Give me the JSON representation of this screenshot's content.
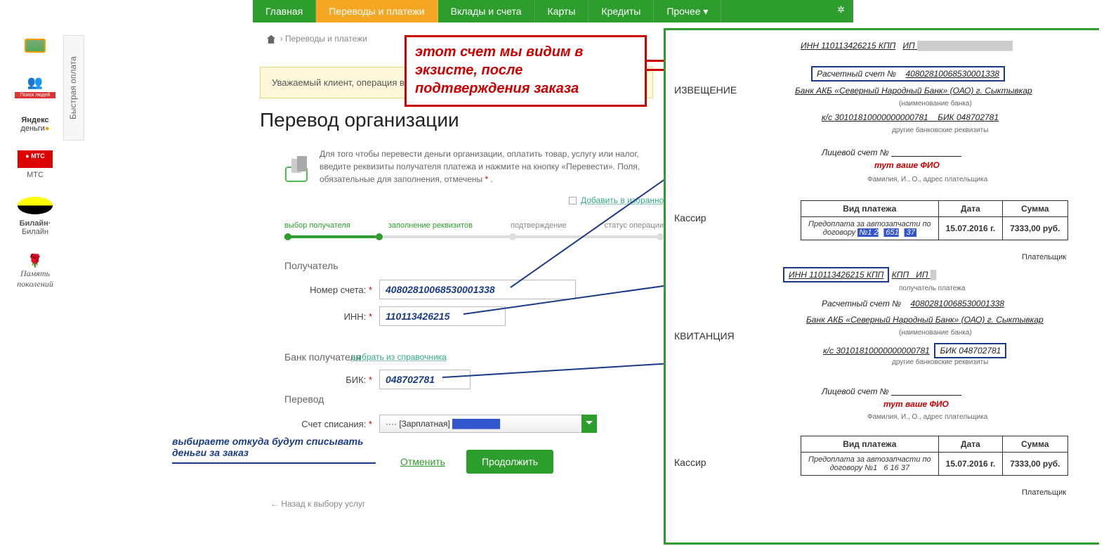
{
  "nav": {
    "home": "Главная",
    "transfers": "Переводы и платежи",
    "deposits": "Вклады и счета",
    "cards": "Карты",
    "credits": "Кредиты",
    "other": "Прочее"
  },
  "quickpay": "Быстрая оплата",
  "sidebar": {
    "mts": "МТС",
    "beeline": "Билайн",
    "yandex_money": "деньги"
  },
  "breadcrumb": "Переводы и платежи",
  "alert": "Уважаемый клиент, операция возм",
  "heading": "Перевод организации",
  "description": "Для того чтобы перевести деньги организации, оплатить товар, услугу или налог, введите реквизиты получателя платежа и нажмите на кнопку «Перевести». Поля, обязательные для заполнения, отмечены",
  "add_favorite": "Добавить в избранное",
  "steps": {
    "s1": "выбор получателя",
    "s2": "заполнение реквизитов",
    "s3": "подтверждение",
    "s4": "статус операции"
  },
  "form": {
    "recipient_section": "Получатель",
    "account_label": "Номер счета:",
    "account_value": "40802810068530001338",
    "inn_label": "ИНН:",
    "inn_value": "110113426215",
    "bank_section": "Банк получателя",
    "directory_link": "выбрать из справочника",
    "bik_label": "БИК:",
    "bik_value": "048702781",
    "transfer_section": "Перевод",
    "writeoff_label": "Счет списания:",
    "writeoff_value": "···· [Зарплатная]",
    "cancel": "Отменить",
    "continue": "Продолжить",
    "back": "← Назад к выбору услуг"
  },
  "redbox": "этот счет мы видим в экзисте, после подтверждения заказа",
  "blueanno": "выбираете откуда будут списывать деньги за заказ",
  "invoice": {
    "notif": "ИЗВЕЩЕНИЕ",
    "cashier": "Кассир",
    "receipt": "КВИТАНЦИЯ",
    "inn_line": "ИНН 110113426215 КПП",
    "ip": "ИП",
    "recipient_label": "получатель платежа",
    "account_label": "Расчетный счет №",
    "account_value": "40802810068530001338",
    "bank": "Банк АКБ «Северный Народный Банк» (ОАО) г. Сыктывкар",
    "bank_label": "(наименование банка)",
    "ks": "к/с 30101810000000000781",
    "bik": "БИК 048702781",
    "other_details": "другие банковские реквизиты",
    "personal_acc": "Лицевой счет №",
    "your_fio": "тут ваше ФИО",
    "fio_label": "Фамилия, И., О., адрес плательщика",
    "payer": "Плательщик",
    "table": {
      "type": "Вид платежа",
      "date": "Дата",
      "sum": "Сумма",
      "desc1": "Предоплата за автозапчасти по",
      "desc2a": "договору",
      "desc2b": "№1",
      "date_val": "15.07.2016 г.",
      "sum_val": "7333,00 руб."
    }
  }
}
